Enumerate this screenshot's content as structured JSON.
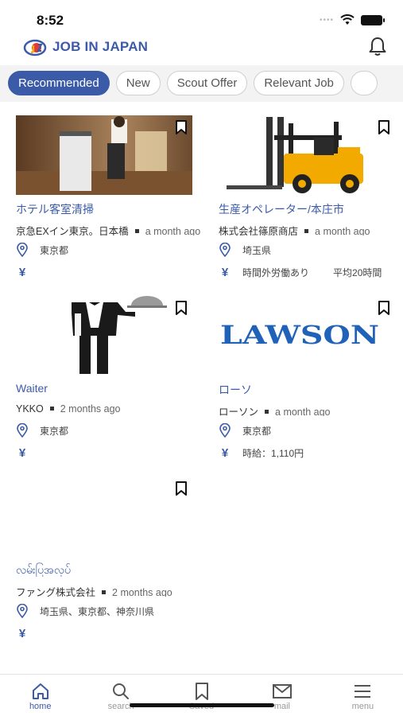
{
  "status_bar": {
    "time": "8:52"
  },
  "header": {
    "logo_text": "JOB IN JAPAN",
    "notification_icon": "bell-icon"
  },
  "tabs": [
    {
      "label": "Recommended",
      "active": true
    },
    {
      "label": "New",
      "active": false
    },
    {
      "label": "Scout Offer",
      "active": false
    },
    {
      "label": "Relevant Job",
      "active": false
    }
  ],
  "jobs": [
    {
      "title": "ホテル客室清掃",
      "company": "京急EXイン東京。日本橋",
      "posted": "a month ago",
      "location": "東京都",
      "salary": "",
      "salary_extra": "",
      "image": "hotel-housekeeping-photo"
    },
    {
      "title": "生産オペレーター/本庄市",
      "company": "株式会社篠原商店",
      "posted": "a month ago",
      "location": "埼玉県",
      "salary": "時間外労働あり",
      "salary_extra": "平均20時間",
      "image": "forklift-photo"
    },
    {
      "title": "Waiter",
      "company": "YKKO",
      "posted": "2 months ago",
      "location": "東京都",
      "salary": "",
      "salary_extra": "",
      "image": "waiter-illustration"
    },
    {
      "title": "ローソ",
      "company": "ローソン",
      "posted": "a month ago",
      "location": "東京都",
      "salary": "時給：1,110円",
      "salary_extra": "",
      "image": "lawson-logo",
      "image_text": "LAWSON"
    },
    {
      "title": "လမ်းပြအလုပ်",
      "company": "ファング株式会社",
      "posted": "2 months ago",
      "location": "埼玉県、東京都、神奈川県",
      "salary": "",
      "salary_extra": "",
      "image": "blank"
    }
  ],
  "bottom_nav": [
    {
      "label": "home",
      "icon": "home-icon",
      "active": true
    },
    {
      "label": "search",
      "icon": "search-icon",
      "active": false
    },
    {
      "label": "Saved",
      "icon": "bookmark-icon",
      "active": false
    },
    {
      "label": "mail",
      "icon": "mail-icon",
      "active": false
    },
    {
      "label": "menu",
      "icon": "menu-icon",
      "active": false
    }
  ],
  "colors": {
    "accent": "#3b5ba9",
    "tab_bar_bg": "#f3f3f3",
    "forklift": "#f2a900"
  }
}
